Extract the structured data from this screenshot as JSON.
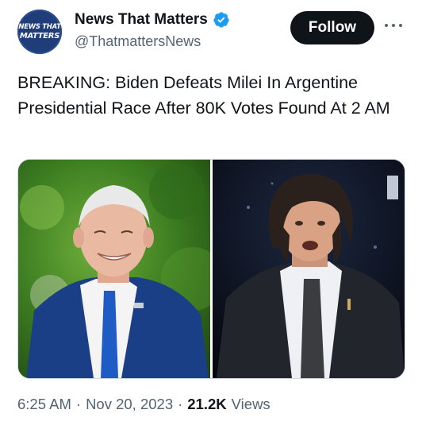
{
  "account": {
    "avatar_text_line1": "NEWS THAT",
    "avatar_text_line2": "MATTERS",
    "name": "News That Matters",
    "handle": "@ThatmattersNews",
    "verified": true
  },
  "actions": {
    "follow_label": "Follow",
    "more_icon": "more-horizontal-icon"
  },
  "post": {
    "text": "BREAKING: Biden Defeats Milei In Argentine Presidential Race After 80K Votes Found At 2 AM",
    "media": {
      "left_image": "photo-smiling-man-blue-suit",
      "right_image": "photo-man-dark-suit-speaking"
    }
  },
  "meta": {
    "time": "6:25 AM",
    "date": "Nov 20, 2023",
    "views_count": "21.2K",
    "views_label": "Views"
  },
  "colors": {
    "text": "#0f1419",
    "secondary": "#536471",
    "verified": "#1d9bf0",
    "follow_bg": "#0f1419"
  }
}
